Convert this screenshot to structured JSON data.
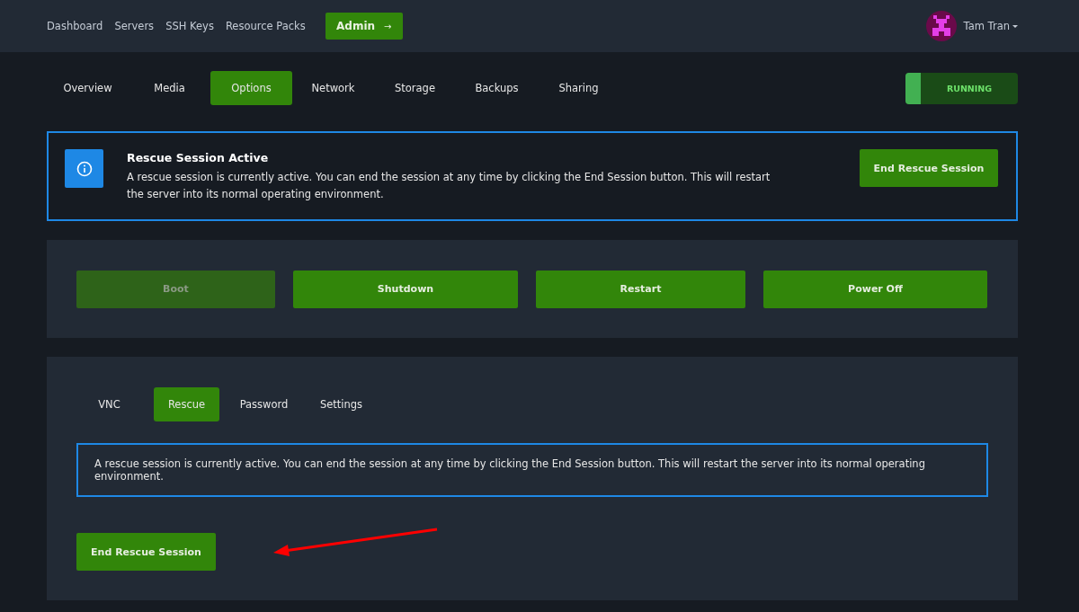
{
  "nav": {
    "links": [
      "Dashboard",
      "Servers",
      "SSH Keys",
      "Resource Packs"
    ],
    "admin": {
      "label": "Admin",
      "arrow": "→"
    },
    "user": {
      "name": "Tam Tran"
    }
  },
  "tabs": [
    {
      "label": "Overview",
      "selected": false
    },
    {
      "label": "Media",
      "selected": false
    },
    {
      "label": "Options",
      "selected": true
    },
    {
      "label": "Network",
      "selected": false
    },
    {
      "label": "Storage",
      "selected": false
    },
    {
      "label": "Backups",
      "selected": false
    },
    {
      "label": "Sharing",
      "selected": false
    }
  ],
  "status": {
    "label": "RUNNING"
  },
  "alert": {
    "title": "Rescue Session Active",
    "text": "A rescue session is currently active. You can end the session at any time by clicking the End Session button. This will restart the server into its normal operating environment.",
    "button": "End Rescue Session"
  },
  "power_buttons": [
    {
      "label": "Boot",
      "disabled": true
    },
    {
      "label": "Shutdown",
      "disabled": false
    },
    {
      "label": "Restart",
      "disabled": false
    },
    {
      "label": "Power Off",
      "disabled": false
    }
  ],
  "subtabs": [
    {
      "label": "VNC",
      "selected": false
    },
    {
      "label": "Rescue",
      "selected": true
    },
    {
      "label": "Password",
      "selected": false
    },
    {
      "label": "Settings",
      "selected": false
    }
  ],
  "rescue": {
    "text": "A rescue session is currently active. You can end the session at any time by clicking the End Session button. This will restart the server into its normal operating environment.",
    "button": "End Rescue Session"
  }
}
